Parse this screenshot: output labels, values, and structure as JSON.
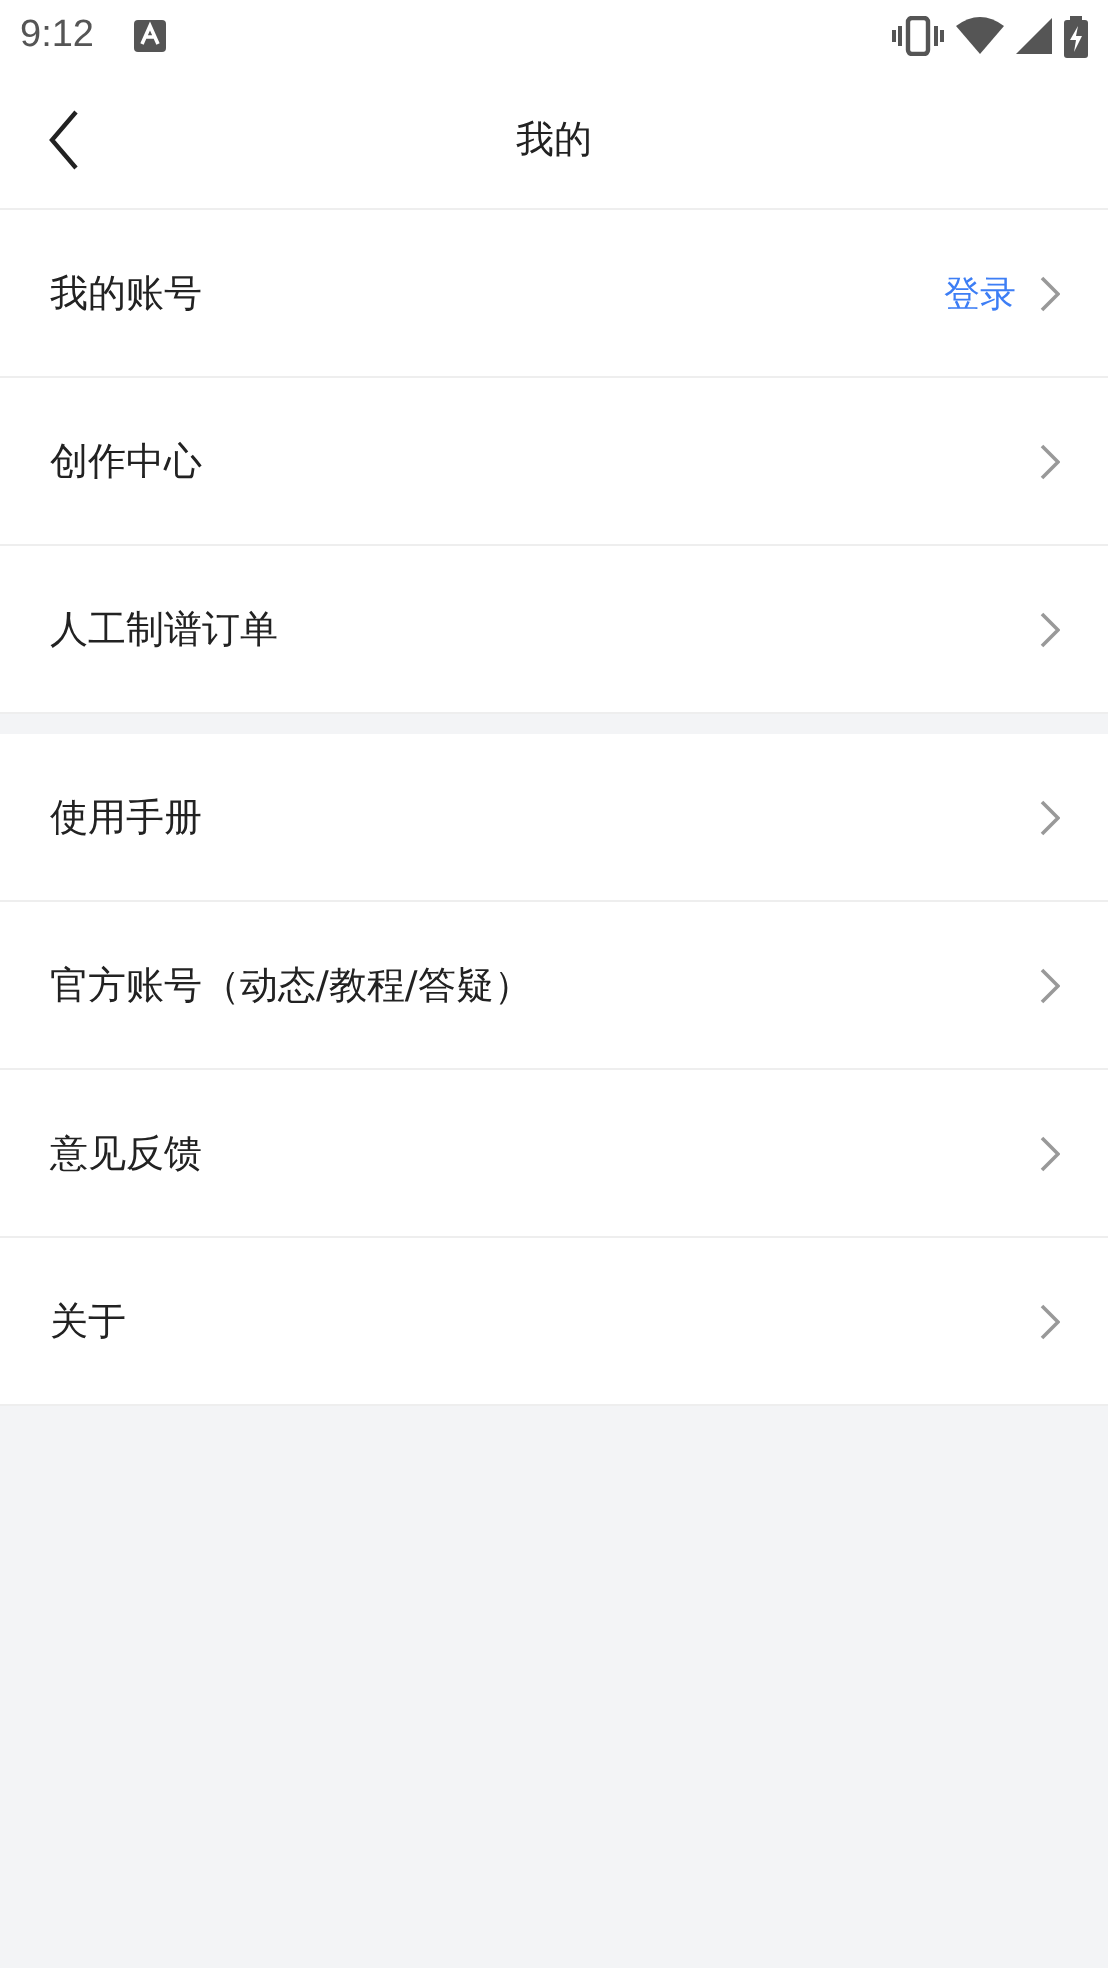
{
  "status_bar": {
    "time": "9:12"
  },
  "header": {
    "title": "我的"
  },
  "sections": [
    {
      "items": [
        {
          "label": "我的账号",
          "value": "登录"
        },
        {
          "label": "创作中心"
        },
        {
          "label": "人工制谱订单"
        }
      ]
    },
    {
      "items": [
        {
          "label": "使用手册"
        },
        {
          "label": "官方账号（动态/教程/答疑）"
        },
        {
          "label": "意见反馈"
        },
        {
          "label": "关于"
        }
      ]
    }
  ]
}
